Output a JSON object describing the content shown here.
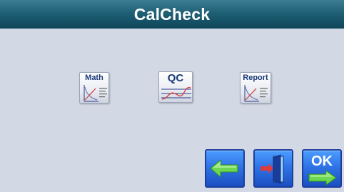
{
  "window": {
    "title": "CalCheck"
  },
  "apps": [
    {
      "label": "Math",
      "icon": "math-chart-icon"
    },
    {
      "label": "QC",
      "icon": "qc-curve-icon"
    },
    {
      "label": "Report",
      "icon": "report-chart-icon"
    }
  ],
  "nav": {
    "back": {
      "icon": "green-arrow-left-icon"
    },
    "exit": {
      "icon": "exit-door-icon"
    },
    "ok": {
      "label": "OK",
      "icon": "green-arrow-right-icon"
    }
  },
  "colors": {
    "titlebar": "#1f6076",
    "background": "#d3d8e5",
    "button_blue": "#2f74e6",
    "arrow_green": "#5fd14a"
  }
}
